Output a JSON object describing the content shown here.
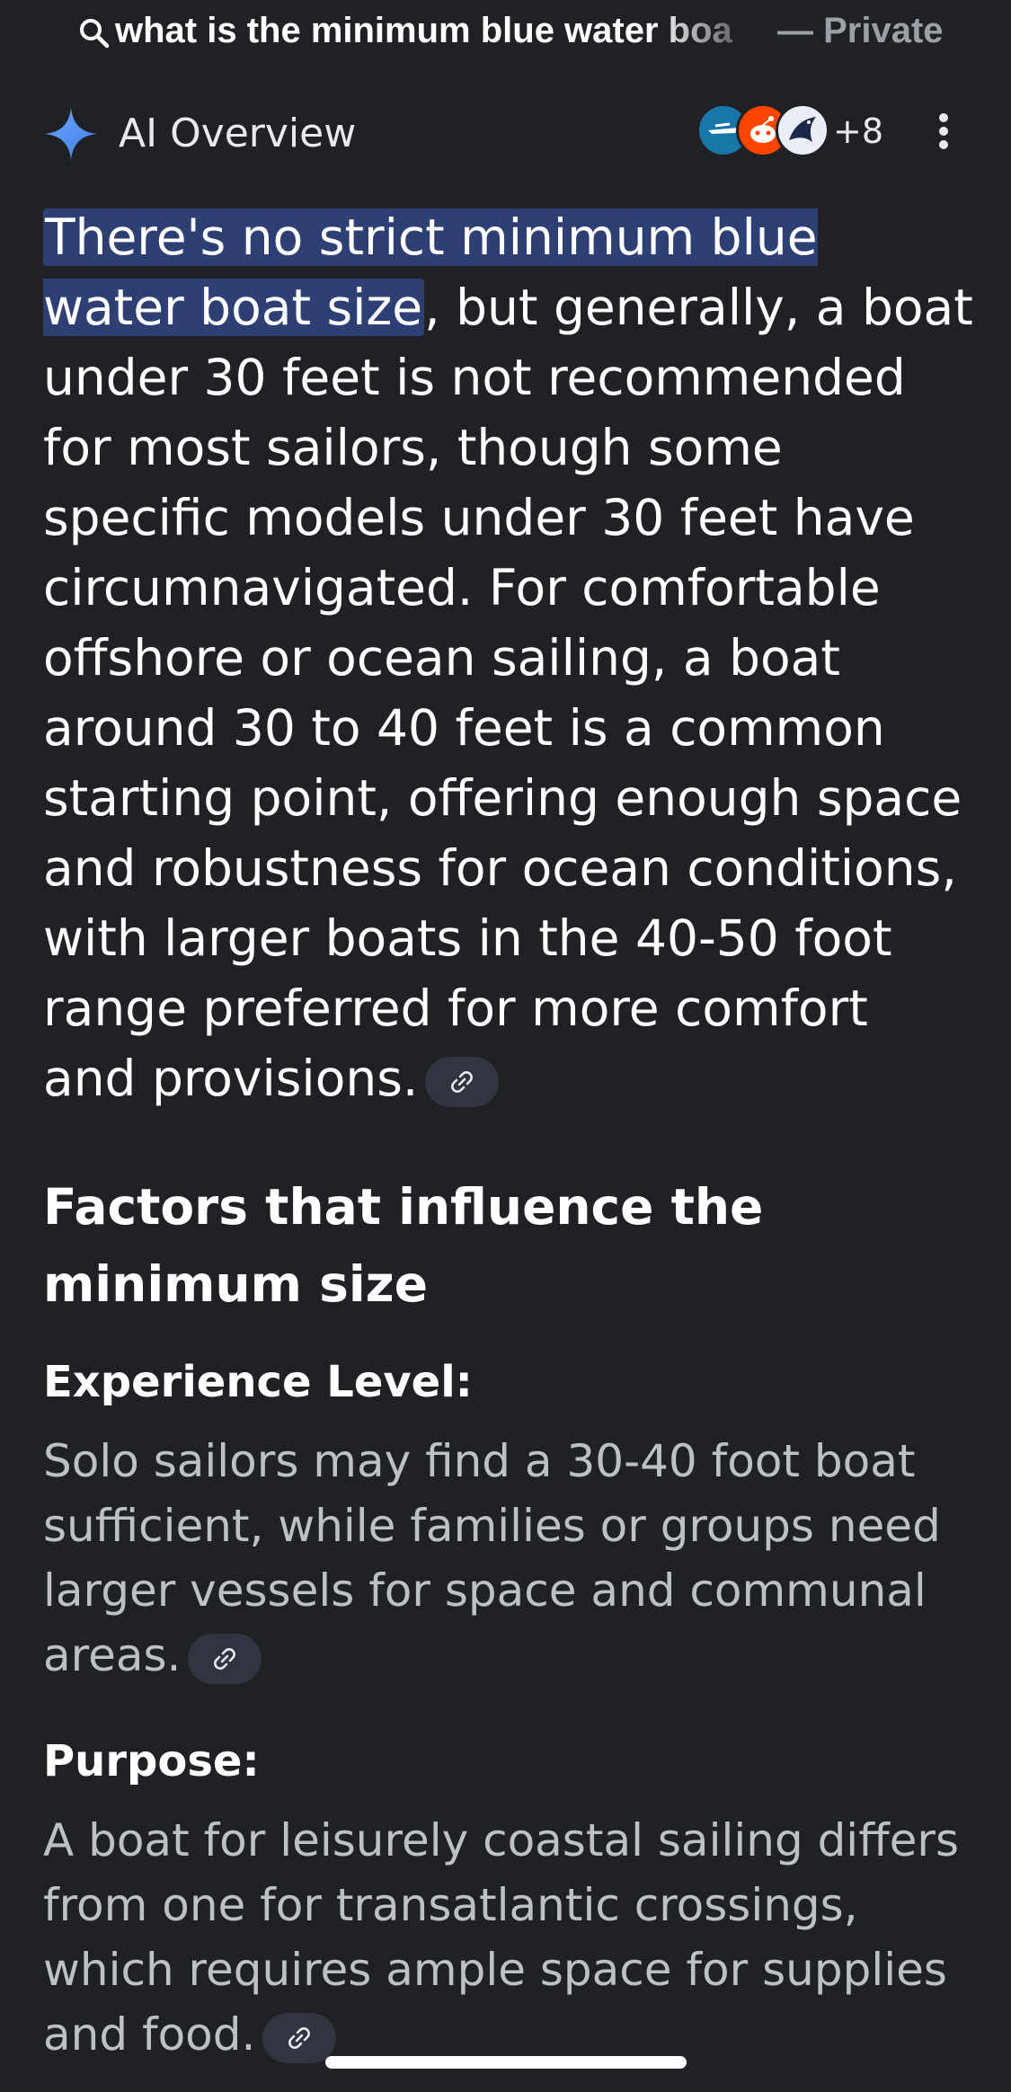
{
  "search_bar": {
    "query": "what is the minimum blue water boa",
    "mode_label": "— Private"
  },
  "ai_overview": {
    "title": "AI Overview",
    "source_more_count": "+8",
    "summary_highlight": "There's no strict minimum blue water boat size",
    "summary_rest": ", but generally, a boat under 30 feet is not recommended for most sailors, though some specific models under 30 feet have circumnavigated. For comfortable offshore or ocean sailing, a boat around 30 to 40 feet is a common starting point, offering enough space and robustness for ocean conditions, with larger boats in the 40-50 foot range preferred for more comfort and provisions."
  },
  "factors": {
    "heading": "Factors that influence the minimum size",
    "items": [
      {
        "title": "Experience Level:",
        "body": "Solo sailors may find a 30-40 foot boat sufficient, while families or groups need larger vessels for space and communal areas."
      },
      {
        "title": "Purpose:",
        "body": "A boat for leisurely coastal sailing differs from one for transatlantic crossings, which requires ample space for supplies and food."
      }
    ]
  },
  "colors": {
    "background": "#202124",
    "highlight": "#2e3f73",
    "accent_sparkle": "#4b8df8",
    "chip": "#303540"
  },
  "icons": [
    "search-icon",
    "sparkle-icon",
    "more-vert-icon",
    "link-icon"
  ]
}
